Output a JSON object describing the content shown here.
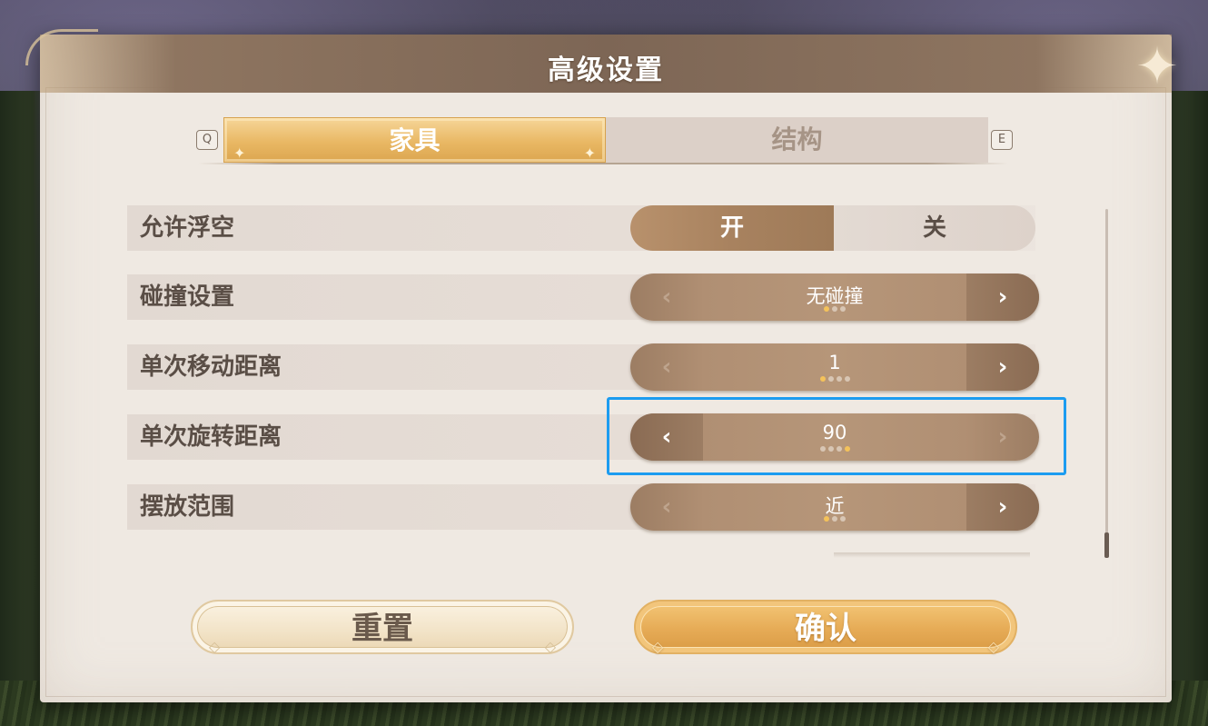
{
  "dialog": {
    "title": "高级设置"
  },
  "tabs": {
    "prev_key": "Q",
    "next_key": "E",
    "items": [
      {
        "label": "家具",
        "active": true
      },
      {
        "label": "结构",
        "active": false
      }
    ]
  },
  "settings": {
    "float": {
      "label": "允许浮空",
      "on_label": "开",
      "off_label": "关",
      "value": "开"
    },
    "collision": {
      "label": "碰撞设置",
      "value": "无碰撞",
      "option_count": 3,
      "selected_index": 0
    },
    "move_step": {
      "label": "单次移动距离",
      "value": "1",
      "option_count": 4,
      "selected_index": 0
    },
    "rotate_step": {
      "label": "单次旋转距离",
      "value": "90",
      "option_count": 4,
      "selected_index": 3
    },
    "place_range": {
      "label": "摆放范围",
      "value": "近",
      "option_count": 3,
      "selected_index": 0
    }
  },
  "icons": {
    "arrow_left": "‹",
    "arrow_right": "›",
    "corner_star": "✦"
  },
  "buttons": {
    "reset": "重置",
    "confirm": "确认"
  },
  "colors": {
    "accent_gold": "#e9b864",
    "focus_blue": "#1c9cf0",
    "selector_brown": "#b08f73"
  }
}
